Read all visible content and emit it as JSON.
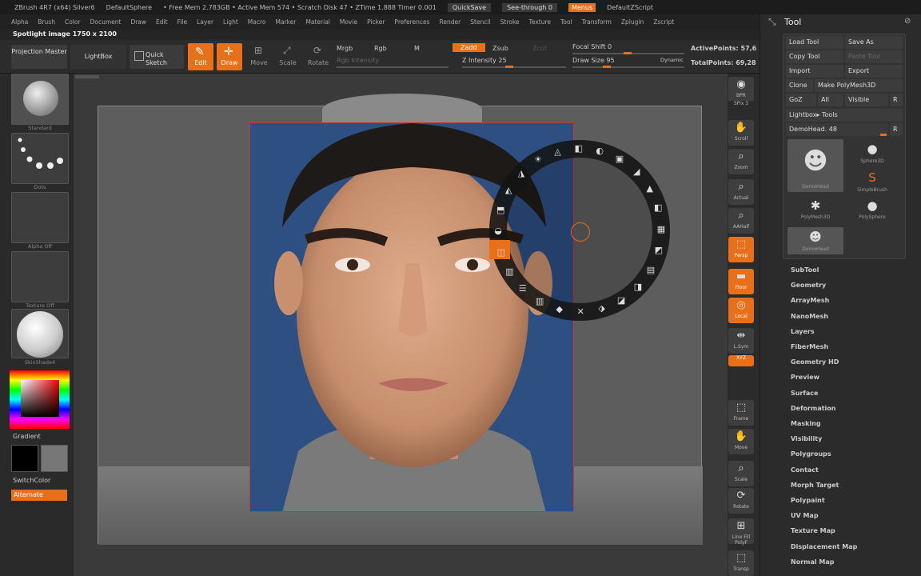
{
  "titlebar": {
    "app": "ZBrush 4R7 (x64) Silver6",
    "doc": "DefaultSphere",
    "stats": "• Free Mem 2.783GB • Active Mem 574 • Scratch Disk 47 • ZTime 1.888 Timer 0.001",
    "quicksave": "QuickSave",
    "seethrough": "See-through  0",
    "menus": "Menus",
    "script": "DefaultZScript"
  },
  "menubar": [
    "Alpha",
    "Brush",
    "Color",
    "Document",
    "Draw",
    "Edit",
    "File",
    "Layer",
    "Light",
    "Macro",
    "Marker",
    "Material",
    "Movie",
    "Picker",
    "Preferences",
    "Render",
    "Stencil",
    "Stroke",
    "Texture",
    "Tool",
    "Transform",
    "Zplugin",
    "Zscript"
  ],
  "status": "Spotlight image 1750 x 2100",
  "toolbar": {
    "projection_master": "Projection Master",
    "lightbox": "LightBox",
    "quick_sketch": "Quick Sketch",
    "edit": "Edit",
    "draw": "Draw",
    "move": "Move",
    "scale": "Scale",
    "rotate": "Rotate",
    "mrgb": "Mrgb",
    "rgb": "Rgb",
    "m": "M",
    "rgb_intensity": "Rgb Intensity",
    "zadd": "Zadd",
    "zsub": "Zsub",
    "zcut": "Zcut",
    "z_intensity": "Z Intensity 25",
    "focal_shift": "Focal Shift 0",
    "draw_size": "Draw Size 95",
    "dynamic": "Dynamic",
    "active_points": "ActivePoints: 57,6",
    "total_points": "TotalPoints: 69,28"
  },
  "leftshelf": {
    "brush": "Standard",
    "stroke": "Dots",
    "alpha": "Alpha Off",
    "texture": "Texture Off",
    "material": "SkinShade4",
    "gradient": "Gradient",
    "switchcolor": "SwitchColor",
    "alternate": "Alternate"
  },
  "rightstrip": [
    "BPR",
    "SPix 3",
    "Scroll",
    "Zoom",
    "Actual",
    "AAHalf",
    "Persp",
    "Floor",
    "Local",
    "L.Sym",
    "XYZ",
    "Frame",
    "Move",
    "Scale",
    "Rotate",
    "Line Fill PolyF",
    "Transp"
  ],
  "toolpanel": {
    "title": "Tool",
    "load_tool": "Load Tool",
    "save_as": "Save As",
    "copy_tool": "Copy Tool",
    "paste_tool": "Paste Tool",
    "import": "Import",
    "export": "Export",
    "clone": "Clone",
    "make_polymesh": "Make PolyMesh3D",
    "goz": "GoZ",
    "all": "All",
    "visible": "Visible",
    "r": "R",
    "lightbox_tools": "Lightbox▸ Tools",
    "current_tool": "DemoHead. 48",
    "thumbs": [
      "DemoHead",
      "Sphere3D",
      "SimpleBrush",
      "PolyMesh3D",
      "PolySphere",
      "DemoHead"
    ],
    "items": [
      "SubTool",
      "Geometry",
      "ArrayMesh",
      "NanoMesh",
      "Layers",
      "FiberMesh",
      "Geometry HD",
      "Preview",
      "Surface",
      "Deformation",
      "Masking",
      "Visibility",
      "Polygroups",
      "Contact",
      "Morph Target",
      "Polypaint",
      "UV Map",
      "Texture Map",
      "Displacement Map",
      "Normal Map"
    ]
  },
  "colors": {
    "accent": "#e8701a",
    "photo_bg": "#2d4f82"
  }
}
